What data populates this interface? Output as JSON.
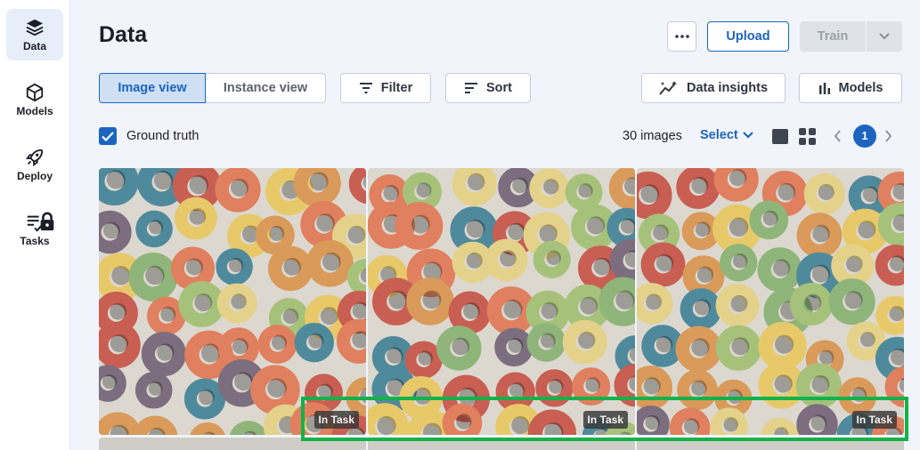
{
  "sidebar": {
    "items": [
      {
        "label": "Data",
        "icon": "layers-icon",
        "active": true
      },
      {
        "label": "Models",
        "icon": "cube-icon",
        "active": false
      },
      {
        "label": "Deploy",
        "icon": "rocket-icon",
        "active": false
      },
      {
        "label": "Tasks",
        "icon": "task-list-icon",
        "active": false,
        "locked": true
      }
    ]
  },
  "header": {
    "title": "Data",
    "more_label": "•••",
    "upload_label": "Upload",
    "train_label": "Train"
  },
  "toolbar": {
    "view_tabs": [
      {
        "label": "Image view",
        "active": true
      },
      {
        "label": "Instance view",
        "active": false
      }
    ],
    "filter_label": "Filter",
    "sort_label": "Sort",
    "insights_label": "Data insights",
    "models_label": "Models"
  },
  "subbar": {
    "ground_truth_label": "Ground truth",
    "ground_truth_checked": true,
    "count_label": "30 images",
    "select_label": "Select",
    "current_page": "1"
  },
  "images": [
    {
      "badge": "In Task"
    },
    {
      "badge": "In Task"
    },
    {
      "badge": "In Task"
    }
  ],
  "colors": {
    "accent": "#1c64c0",
    "highlight": "#12b24a",
    "sidebar_active": "#e5eef9",
    "background": "#f1f5fb"
  }
}
